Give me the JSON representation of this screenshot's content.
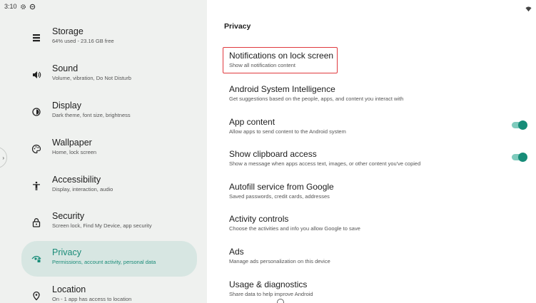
{
  "status_bar": {
    "time": "3:10"
  },
  "sidebar": {
    "items": [
      {
        "icon": "storage-icon",
        "title": "Storage",
        "subtitle": "64% used - 23.16 GB free"
      },
      {
        "icon": "volume-icon",
        "title": "Sound",
        "subtitle": "Volume, vibration, Do Not Disturb"
      },
      {
        "icon": "brightness-icon",
        "title": "Display",
        "subtitle": "Dark theme, font size, brightness"
      },
      {
        "icon": "palette-icon",
        "title": "Wallpaper",
        "subtitle": "Home, lock screen"
      },
      {
        "icon": "accessibility-icon",
        "title": "Accessibility",
        "subtitle": "Display, interaction, audio"
      },
      {
        "icon": "lock-icon",
        "title": "Security",
        "subtitle": "Screen lock, Find My Device, app security"
      },
      {
        "icon": "privacy-eye-icon",
        "title": "Privacy",
        "subtitle": "Permissions, account activity, personal data",
        "active": true
      },
      {
        "icon": "location-pin-icon",
        "title": "Location",
        "subtitle": "On - 1 app has access to location"
      }
    ]
  },
  "main": {
    "title": "Privacy",
    "prefs": [
      {
        "title": "Notifications on lock screen",
        "subtitle": "Show all notification content",
        "highlighted": true
      },
      {
        "title": "Android System Intelligence",
        "subtitle": "Get suggestions based on the people, apps, and content you interact with"
      },
      {
        "title": "App content",
        "subtitle": "Allow apps to send content to the Android system",
        "toggle": true
      },
      {
        "title": "Show clipboard access",
        "subtitle": "Show a message when apps access text, images, or other content you've copied",
        "toggle": true
      },
      {
        "title": "Autofill service from Google",
        "subtitle": "Saved passwords, credit cards, addresses"
      },
      {
        "title": "Activity controls",
        "subtitle": "Choose the activities and info you allow Google to save"
      },
      {
        "title": "Ads",
        "subtitle": "Manage ads personalization on this device"
      },
      {
        "title": "Usage & diagnostics",
        "subtitle": "Share data to help improve Android"
      }
    ]
  },
  "colors": {
    "accent": "#178c78",
    "active_bg": "#d7e6e2",
    "highlight_border": "#e0393e",
    "sidebar_bg": "#eff1ef"
  }
}
